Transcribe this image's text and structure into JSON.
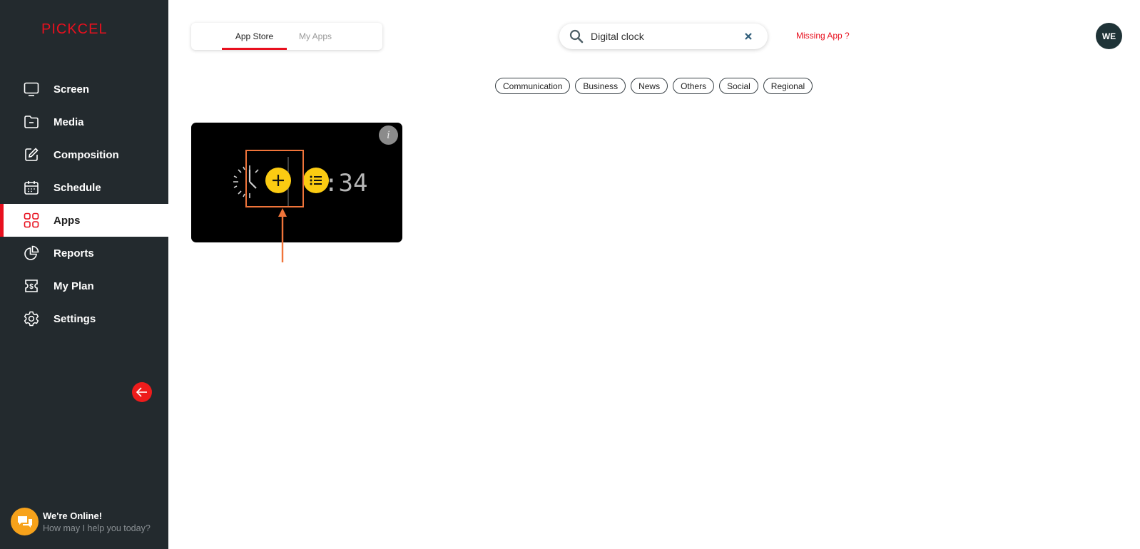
{
  "brand": {
    "logo_text": "PICKCEL",
    "accent": "#e8101e"
  },
  "sidebar": {
    "items": [
      {
        "label": "Screen",
        "icon": "monitor-icon"
      },
      {
        "label": "Media",
        "icon": "folder-icon"
      },
      {
        "label": "Composition",
        "icon": "edit-icon"
      },
      {
        "label": "Schedule",
        "icon": "calendar-icon"
      },
      {
        "label": "Apps",
        "icon": "apps-grid-icon",
        "active": true
      },
      {
        "label": "Reports",
        "icon": "pie-chart-icon"
      },
      {
        "label": "My Plan",
        "icon": "dollar-icon"
      },
      {
        "label": "Settings",
        "icon": "gear-icon"
      }
    ],
    "chat": {
      "title": "We're Online!",
      "subtitle": "How may I help you today?"
    }
  },
  "tabs": {
    "items": [
      "App Store",
      "My Apps"
    ],
    "active": "App Store"
  },
  "search": {
    "value": "Digital clock",
    "placeholder": "Search"
  },
  "missing_app": "Missing App ?",
  "user": {
    "initials": "WE"
  },
  "categories": [
    "Communication",
    "Business",
    "News",
    "Others",
    "Social",
    "Regional"
  ],
  "app_card": {
    "clock_time": ":34",
    "info_glyph": "i"
  }
}
